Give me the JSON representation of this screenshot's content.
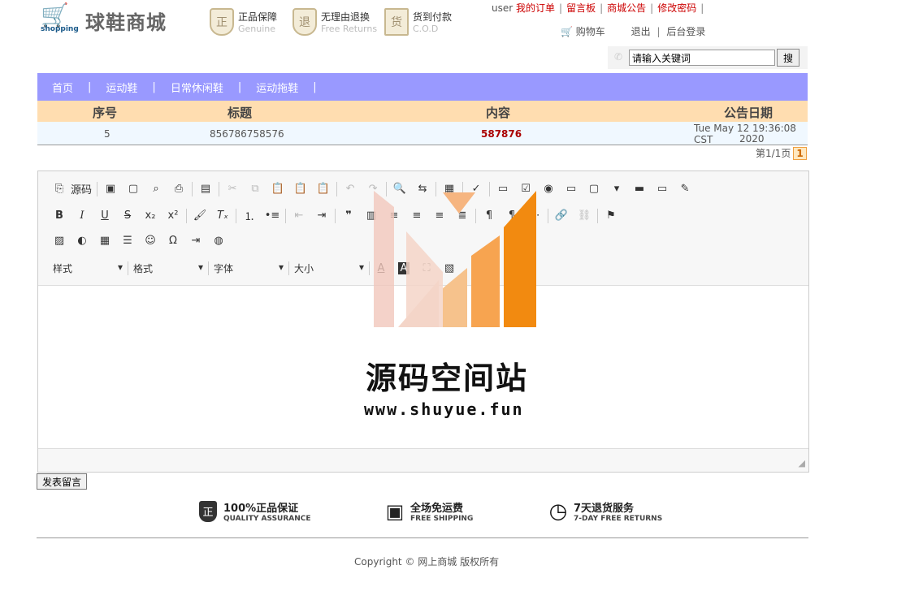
{
  "header": {
    "logo_text": "shopping",
    "site_title": "球鞋商城",
    "badges": [
      {
        "icon": "正",
        "title": "正品保障",
        "subtitle": "Genuine"
      },
      {
        "icon": "退",
        "title": "无理由退换",
        "subtitle": "Free Returns"
      },
      {
        "icon": "货",
        "title": "货到付款",
        "subtitle": "C.O.D"
      }
    ],
    "user": "user",
    "links": [
      "我的订单",
      "留言板",
      "商城公告",
      "修改密码"
    ],
    "cart": "购物车",
    "logout": "退出",
    "admin": "后台登录",
    "search_placeholder": "请输入关键词",
    "search_button": "搜"
  },
  "nav": [
    "首页",
    "运动鞋",
    "日常休闲鞋",
    "运动拖鞋"
  ],
  "table": {
    "headers": [
      "序号",
      "标题",
      "内容",
      "公告日期"
    ],
    "row": {
      "id": "5",
      "title": "856786758576",
      "content": "587876",
      "date1": "Tue May 12 19:36:08 CST",
      "date2": "2020"
    },
    "pager_text": "第1/1页",
    "pager_current": "1"
  },
  "editor": {
    "source_label": "源码",
    "combos": [
      "样式",
      "格式",
      "字体",
      "大小"
    ]
  },
  "watermark": {
    "title": "源码空间站",
    "url": "www.shuyue.fun"
  },
  "submit_label": "发表留言",
  "features": [
    {
      "icon": "正",
      "t1": "100%正品保证",
      "t2": "QUALITY ASSURANCE"
    },
    {
      "icon": "▣",
      "t1": "全场免运费",
      "t2": "FREE SHIPPING"
    },
    {
      "icon": "◷",
      "t1": "7天退货服务",
      "t2": "7-DAY FREE RETURNS"
    }
  ],
  "copyright": "Copyright © 网上商城 版权所有",
  "colors": {
    "nav_bg": "#9999ff",
    "table_head_bg": "#ffddb0",
    "link": "#cc0000"
  }
}
